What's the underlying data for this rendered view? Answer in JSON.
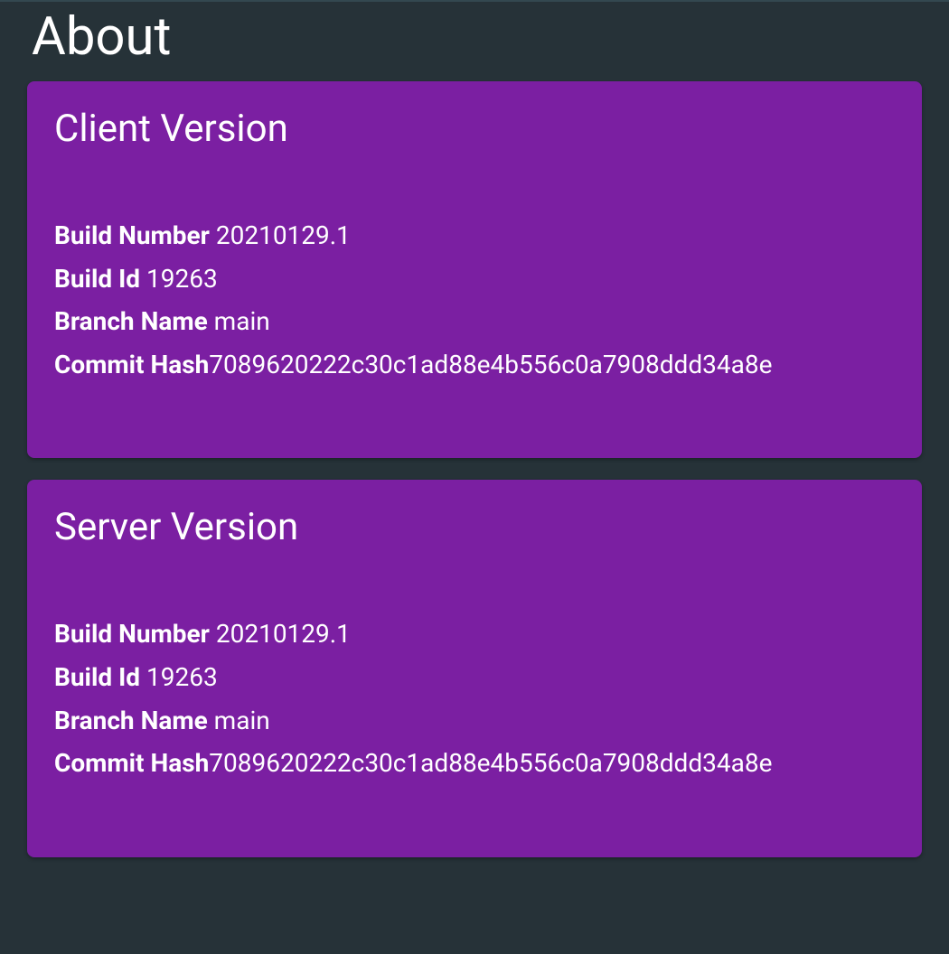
{
  "page": {
    "title": "About"
  },
  "client": {
    "title": "Client Version",
    "fields": {
      "build_number_label": "Build Number",
      "build_number_value": "20210129.1",
      "build_id_label": "Build Id",
      "build_id_value": "19263",
      "branch_name_label": "Branch Name",
      "branch_name_value": "main",
      "commit_hash_label": "Commit Hash",
      "commit_hash_value": "7089620222c30c1ad88e4b556c0a7908ddd34a8e"
    }
  },
  "server": {
    "title": "Server Version",
    "fields": {
      "build_number_label": "Build Number",
      "build_number_value": "20210129.1",
      "build_id_label": "Build Id",
      "build_id_value": "19263",
      "branch_name_label": "Branch Name",
      "branch_name_value": "main",
      "commit_hash_label": "Commit Hash",
      "commit_hash_value": "7089620222c30c1ad88e4b556c0a7908ddd34a8e"
    }
  }
}
